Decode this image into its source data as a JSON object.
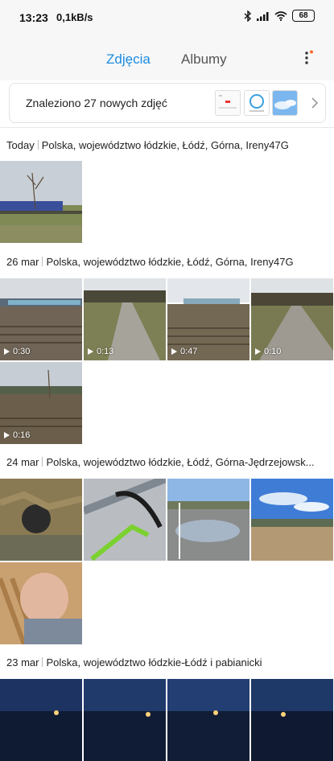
{
  "status": {
    "time": "13:23",
    "speed": "0,1kB/s",
    "battery": "68",
    "icons": [
      "bluetooth-icon",
      "signal-icon",
      "wifi-icon",
      "battery-icon"
    ]
  },
  "tabs": {
    "photos": "Zdjęcia",
    "albums": "Albumy",
    "active": "photos",
    "accent": "#1b8ce0"
  },
  "banner": {
    "text": "Znaleziono 27 nowych zdjęć"
  },
  "sections": [
    {
      "date": "Today",
      "place": "Polska, województwo łódzkie, Łódź, Górna, Ireny47G",
      "items": [
        {
          "type": "photo",
          "duration": ""
        }
      ]
    },
    {
      "date": "26 mar",
      "place": "Polska, województwo łódzkie, Łódź, Górna, Ireny47G",
      "items": [
        {
          "type": "video",
          "duration": "0:30"
        },
        {
          "type": "video",
          "duration": "0:13"
        },
        {
          "type": "video",
          "duration": "0:47"
        },
        {
          "type": "video",
          "duration": "0:10"
        },
        {
          "type": "video",
          "duration": "0:16"
        }
      ]
    },
    {
      "date": "24 mar",
      "place": "Polska, województwo łódzkie, Łódź, Górna-Jędrzejowsk...",
      "items": [
        {
          "type": "photo",
          "duration": ""
        },
        {
          "type": "photo",
          "duration": ""
        },
        {
          "type": "photo",
          "duration": ""
        },
        {
          "type": "photo",
          "duration": ""
        },
        {
          "type": "photo",
          "duration": ""
        }
      ]
    },
    {
      "date": "23 mar",
      "place": "Polska, województwo łódzkie-Łódź i pabianicki",
      "items": [
        {
          "type": "photo",
          "duration": ""
        },
        {
          "type": "photo",
          "duration": ""
        },
        {
          "type": "photo",
          "duration": ""
        },
        {
          "type": "photo",
          "duration": ""
        }
      ]
    }
  ]
}
